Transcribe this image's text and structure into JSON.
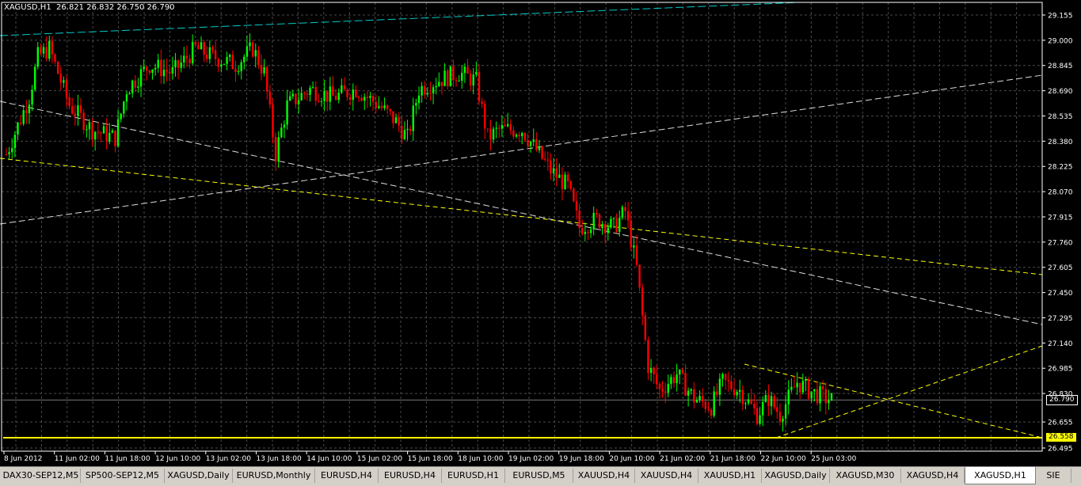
{
  "header": {
    "symbol_info": "XAGUSD,H1  26.821 26.832 26.750 26.790"
  },
  "price_axis": {
    "labels": [
      "29.155",
      "29.000",
      "28.845",
      "28.690",
      "28.535",
      "28.380",
      "28.225",
      "28.070",
      "27.915",
      "27.760",
      "27.605",
      "27.450",
      "27.295",
      "27.140",
      "26.985",
      "26.830",
      "26.655",
      "26.495"
    ],
    "current_price": "26.790",
    "support_price": "26.558"
  },
  "time_axis": {
    "labels": [
      "8 Jun 2012",
      "11 Jun 02:00",
      "11 Jun 18:00",
      "12 Jun 10:00",
      "13 Jun 02:00",
      "13 Jun 18:00",
      "14 Jun 10:00",
      "15 Jun 02:00",
      "15 Jun 18:00",
      "18 Jun 10:00",
      "19 Jun 02:00",
      "19 Jun 18:00",
      "20 Jun 10:00",
      "21 Jun 02:00",
      "21 Jun 18:00",
      "22 Jun 10:00",
      "25 Jun 03:00"
    ]
  },
  "colors": {
    "background": "#000000",
    "grid": "#4a4a4a",
    "bull": "#00ff00",
    "bear": "#ff0000",
    "trendline_white": "#dddddd",
    "trendline_yellow": "#ffff00",
    "trendline_cyan": "#00cccc",
    "support_line": "#ffff00"
  },
  "tabs": [
    {
      "label": "DAX30-SEP12,M5"
    },
    {
      "label": "SP500-SEP12,M5"
    },
    {
      "label": "XAGUSD,Daily"
    },
    {
      "label": "EURUSD,Monthly"
    },
    {
      "label": "EURUSD,H4"
    },
    {
      "label": "EURUSD,H4"
    },
    {
      "label": "EURUSD,H1"
    },
    {
      "label": "EURUSD,M5"
    },
    {
      "label": "XAUUSD,H4"
    },
    {
      "label": "XAUUSD,H4"
    },
    {
      "label": "XAUUSD,H1"
    },
    {
      "label": "XAGUSD,Daily"
    },
    {
      "label": "XAGUSD,M30"
    },
    {
      "label": "XAGUSD,H4"
    },
    {
      "label": "XAGUSD,H1",
      "active": true
    },
    {
      "label": "SIE"
    }
  ],
  "chart_data": {
    "type": "candlestick",
    "symbol": "XAGUSD",
    "timeframe": "H1",
    "ohlc_last": {
      "open": 26.821,
      "high": 26.832,
      "low": 26.75,
      "close": 26.79
    },
    "ylim": [
      26.495,
      29.155
    ],
    "grid": true,
    "anchors": [
      {
        "i": 0,
        "p": 28.3
      },
      {
        "i": 8,
        "p": 28.65
      },
      {
        "i": 11,
        "p": 28.9
      },
      {
        "i": 15,
        "p": 28.95
      },
      {
        "i": 22,
        "p": 28.6
      },
      {
        "i": 30,
        "p": 28.45
      },
      {
        "i": 38,
        "p": 28.4
      },
      {
        "i": 42,
        "p": 28.7
      },
      {
        "i": 50,
        "p": 28.85
      },
      {
        "i": 58,
        "p": 28.8
      },
      {
        "i": 66,
        "p": 28.95
      },
      {
        "i": 72,
        "p": 28.9
      },
      {
        "i": 80,
        "p": 28.85
      },
      {
        "i": 86,
        "p": 28.95
      },
      {
        "i": 90,
        "p": 28.8
      },
      {
        "i": 94,
        "p": 28.3
      },
      {
        "i": 98,
        "p": 28.6
      },
      {
        "i": 106,
        "p": 28.7
      },
      {
        "i": 114,
        "p": 28.65
      },
      {
        "i": 122,
        "p": 28.7
      },
      {
        "i": 130,
        "p": 28.6
      },
      {
        "i": 136,
        "p": 28.5
      },
      {
        "i": 140,
        "p": 28.4
      },
      {
        "i": 144,
        "p": 28.7
      },
      {
        "i": 150,
        "p": 28.75
      },
      {
        "i": 158,
        "p": 28.8
      },
      {
        "i": 164,
        "p": 28.75
      },
      {
        "i": 168,
        "p": 28.4
      },
      {
        "i": 172,
        "p": 28.45
      },
      {
        "i": 180,
        "p": 28.45
      },
      {
        "i": 186,
        "p": 28.3
      },
      {
        "i": 190,
        "p": 28.2
      },
      {
        "i": 196,
        "p": 28.1
      },
      {
        "i": 200,
        "p": 27.85
      },
      {
        "i": 206,
        "p": 27.9
      },
      {
        "i": 212,
        "p": 27.85
      },
      {
        "i": 216,
        "p": 27.95
      },
      {
        "i": 220,
        "p": 27.6
      },
      {
        "i": 224,
        "p": 27.0
      },
      {
        "i": 228,
        "p": 26.85
      },
      {
        "i": 234,
        "p": 26.95
      },
      {
        "i": 240,
        "p": 26.8
      },
      {
        "i": 246,
        "p": 26.75
      },
      {
        "i": 250,
        "p": 26.9
      },
      {
        "i": 256,
        "p": 26.85
      },
      {
        "i": 262,
        "p": 26.7
      },
      {
        "i": 266,
        "p": 26.8
      },
      {
        "i": 270,
        "p": 26.7
      },
      {
        "i": 276,
        "p": 26.9
      },
      {
        "i": 280,
        "p": 26.85
      },
      {
        "i": 286,
        "p": 26.8
      },
      {
        "i": 288,
        "p": 26.79
      }
    ]
  }
}
